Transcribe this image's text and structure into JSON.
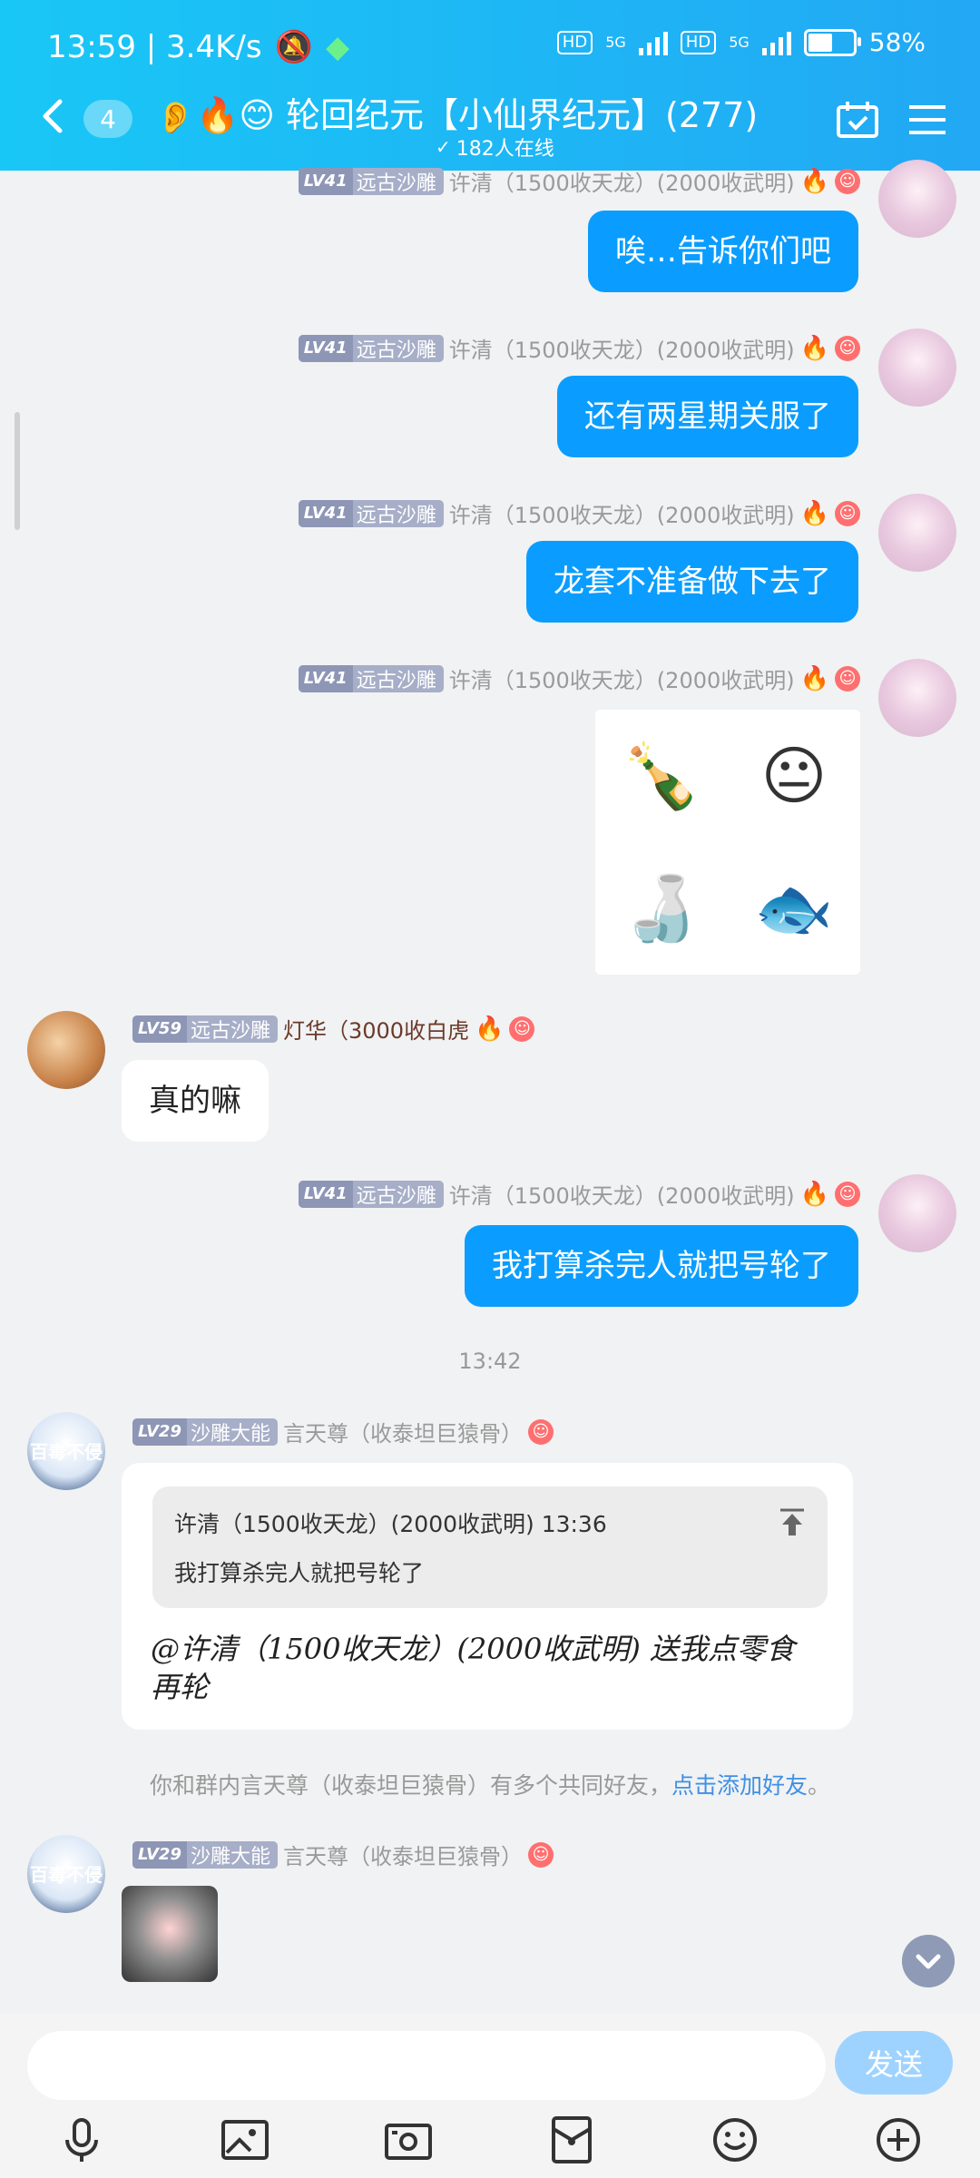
{
  "status": {
    "time_speed": "13:59 | 3.4K/s",
    "net1": "5G",
    "net2": "5G",
    "hd": "HD",
    "battery": "58%",
    "battery_fraction": 0.58
  },
  "header": {
    "back_count": "4",
    "title": "🔥😊 轮回纪元【小仙界纪元】(277)",
    "online": "182人在线"
  },
  "messages": {
    "m1": {
      "level": "LV41",
      "title": "远古沙雕",
      "name": "许清（1500收天龙）(2000收武明)",
      "text": "唉…告诉你们吧"
    },
    "m2": {
      "level": "LV41",
      "title": "远古沙雕",
      "name": "许清（1500收天龙）(2000收武明)",
      "text": "还有两星期关服了"
    },
    "m3": {
      "level": "LV41",
      "title": "远古沙雕",
      "name": "许清（1500收天龙）(2000收武明)",
      "text": "龙套不准备做下去了"
    },
    "m4": {
      "level": "LV41",
      "title": "远古沙雕",
      "name": "许清（1500收天龙）(2000收武明)"
    },
    "m5": {
      "level": "LV59",
      "title": "远古沙雕",
      "name": "灯华（3000收白虎",
      "text": "真的嘛"
    },
    "m6": {
      "level": "LV41",
      "title": "远古沙雕",
      "name": "许清（1500收天龙）(2000收武明)",
      "text": "我打算杀完人就把号轮了"
    },
    "time_divider": "13:42",
    "m7": {
      "level": "LV29",
      "title": "沙雕大能",
      "name": "言天尊（收泰坦巨猿骨）",
      "quote_head": "许清（1500收天龙）(2000收武明)  13:36",
      "quote_body": "我打算杀完人就把号轮了",
      "text": "@许清（1500收天龙）(2000收武明) 送我点零食再轮",
      "avatar_text": "百毒不侵"
    },
    "tip_text": "你和群内言天尊（收泰坦巨猿骨）有多个共同好友，",
    "tip_link": "点击添加好友",
    "tip_end": "。",
    "m8": {
      "level": "LV29",
      "title": "沙雕大能",
      "name": "言天尊（收泰坦巨猿骨）",
      "avatar_text": "百毒不侵"
    }
  },
  "input": {
    "placeholder": "",
    "send_label": "发送"
  },
  "toolbar": {
    "icons": [
      "mic-icon",
      "image-icon",
      "camera-icon",
      "red-packet-icon",
      "emoji-icon",
      "plus-icon"
    ]
  }
}
